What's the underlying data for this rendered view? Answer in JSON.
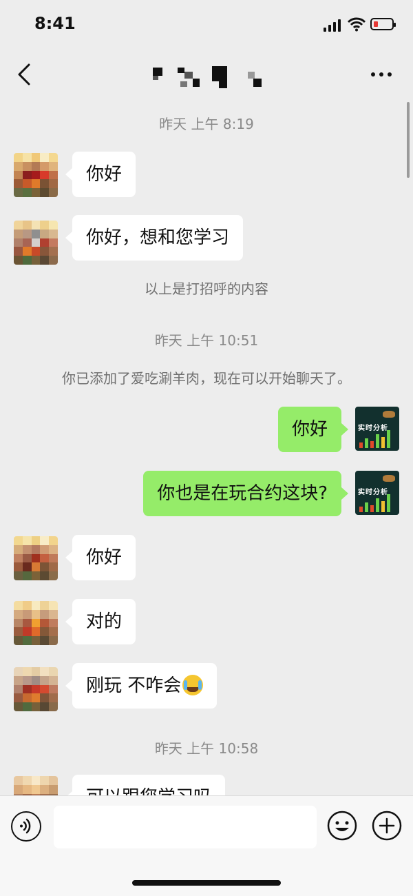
{
  "status_bar": {
    "time": "8:41",
    "battery_level": 0.12,
    "battery_color": "#e53935"
  },
  "nav": {
    "back_icon": "chevron-left-icon",
    "more_icon": "more-dots-icon",
    "title_obscured": true
  },
  "colors": {
    "incoming_bubble": "#ffffff",
    "outgoing_bubble": "#95ec69",
    "background": "#ededed"
  },
  "chat": {
    "timestamp_1": "昨天 上午 8:19",
    "greet_1": "你好",
    "greet_2": "你好，想和您学习",
    "greeting_note": "以上是打招呼的内容",
    "timestamp_2": "昨天 上午 10:51",
    "added_note": "你已添加了爱吃涮羊肉，现在可以开始聊天了。",
    "out_1": "你好",
    "out_2": "你也是在玩合约这块?",
    "in_1": "你好",
    "in_2": "对的",
    "in_3": "刚玩 不咋会",
    "in_3_emoji": "crying-laughing-emoji",
    "timestamp_3": "昨天 上午 10:58",
    "in_4_partial": "可以跟您学习吗"
  },
  "self_avatar": {
    "brand_text": "实时分析"
  },
  "input_bar": {
    "placeholder": "",
    "voice_icon": "voice-icon",
    "emoji_icon": "emoji-icon",
    "plus_icon": "plus-icon"
  }
}
